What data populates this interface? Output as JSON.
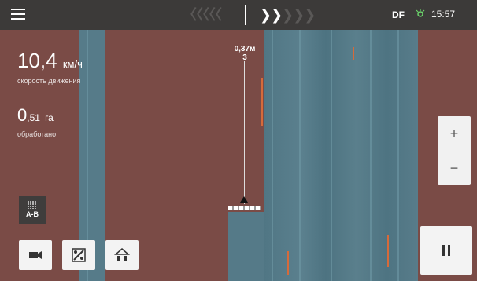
{
  "topbar": {
    "status_label": "DF",
    "clock": "15:57",
    "chevrons_left": "〈〈〈〈〈",
    "chevrons_right_active": "❯❯",
    "chevrons_right_dim": "❯❯❯",
    "icons": [
      "menu-icon",
      "gps-satellite-icon"
    ]
  },
  "metrics": {
    "speed_value": "10,4",
    "speed_unit": "км/ч",
    "speed_label": "скорость движения",
    "area_value": "0",
    "area_decimal": ",51",
    "area_unit": "га",
    "area_label": "обработано"
  },
  "guidance": {
    "offset": "0,37м",
    "line_index": "3"
  },
  "controls": {
    "zoom_in": "+",
    "zoom_out": "−",
    "ab_label": "A-B",
    "tools": [
      "camera-icon",
      "section-control-icon",
      "implement-icon"
    ],
    "pause_icon": "pause-icon"
  },
  "colors": {
    "field": "#7a4b46",
    "covered_area": "#567b89",
    "topbar": "#3c3a39",
    "overlap_marker": "#d66a3a"
  }
}
